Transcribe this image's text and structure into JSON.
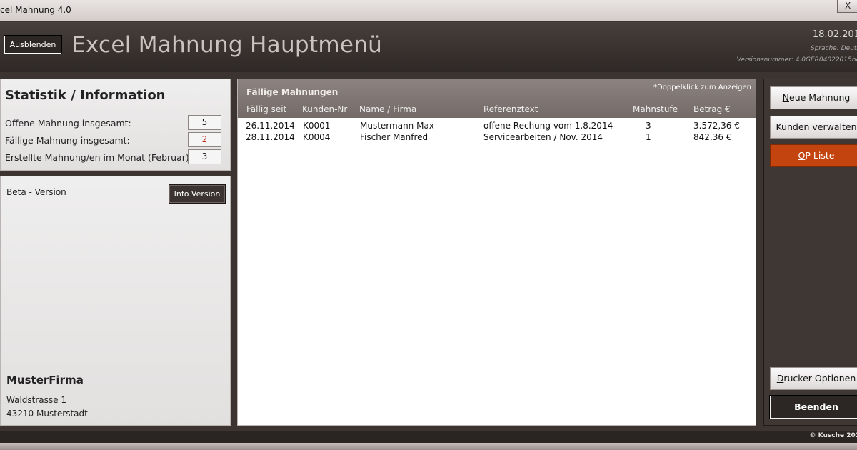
{
  "window": {
    "title": "cel Mahnung 4.0",
    "close": "X"
  },
  "header": {
    "hide_label": "Ausblenden",
    "title": "Excel Mahnung Hauptmenü",
    "date": "18.02.201",
    "language": "Sprache: Deuts",
    "version": "Versionsnummer: 4.0GER04022015be"
  },
  "stats": {
    "heading": "Statistik / Information",
    "rows": [
      {
        "label": "Offene Mahnung insgesamt:",
        "value": "5"
      },
      {
        "label": "Fällige Mahnung insgesamt:",
        "value": "2"
      },
      {
        "label": "Erstellte Mahnung/en im Monat (Februar):",
        "value": "3"
      }
    ],
    "highlight_color": "#c0281c"
  },
  "info": {
    "beta": "Beta - Version",
    "info_button": "Info Version",
    "company": "MusterFirma",
    "street": "Waldstrasse 1",
    "city": "43210 Musterstadt"
  },
  "list": {
    "title": "Fällige Mahnungen",
    "hint": "*Doppelklick zum Anzeigen",
    "columns": [
      "Fällig seit",
      "Kunden-Nr",
      "Name / Firma",
      "Referenztext",
      "Mahnstufe",
      "Betrag €"
    ],
    "rows": [
      {
        "date": "26.11.2014",
        "kunde": "K0001",
        "name": "Mustermann Max",
        "ref": "offene Rechung vom 1.8.2014",
        "stufe": "3",
        "betrag": "3.572,36 €"
      },
      {
        "date": "28.11.2014",
        "kunde": "K0004",
        "name": "Fischer Manfred",
        "ref": "Servicearbeiten / Nov. 2014",
        "stufe": "1",
        "betrag": "842,36 €"
      }
    ]
  },
  "sidebar": {
    "buttons": {
      "new": {
        "pre": "",
        "accel": "N",
        "post": "eue Mahnung"
      },
      "customers": {
        "pre": "",
        "accel": "K",
        "post": "unden verwalten"
      },
      "op": {
        "pre": "",
        "accel": "O",
        "post": "P Liste"
      },
      "print": {
        "pre": "",
        "accel": "D",
        "post": "rucker Optionen"
      },
      "quit": {
        "pre": "",
        "accel": "B",
        "post": "eenden"
      }
    },
    "op_color": "#c3440f"
  },
  "footer": {
    "copyright": "© Kusche 201"
  }
}
